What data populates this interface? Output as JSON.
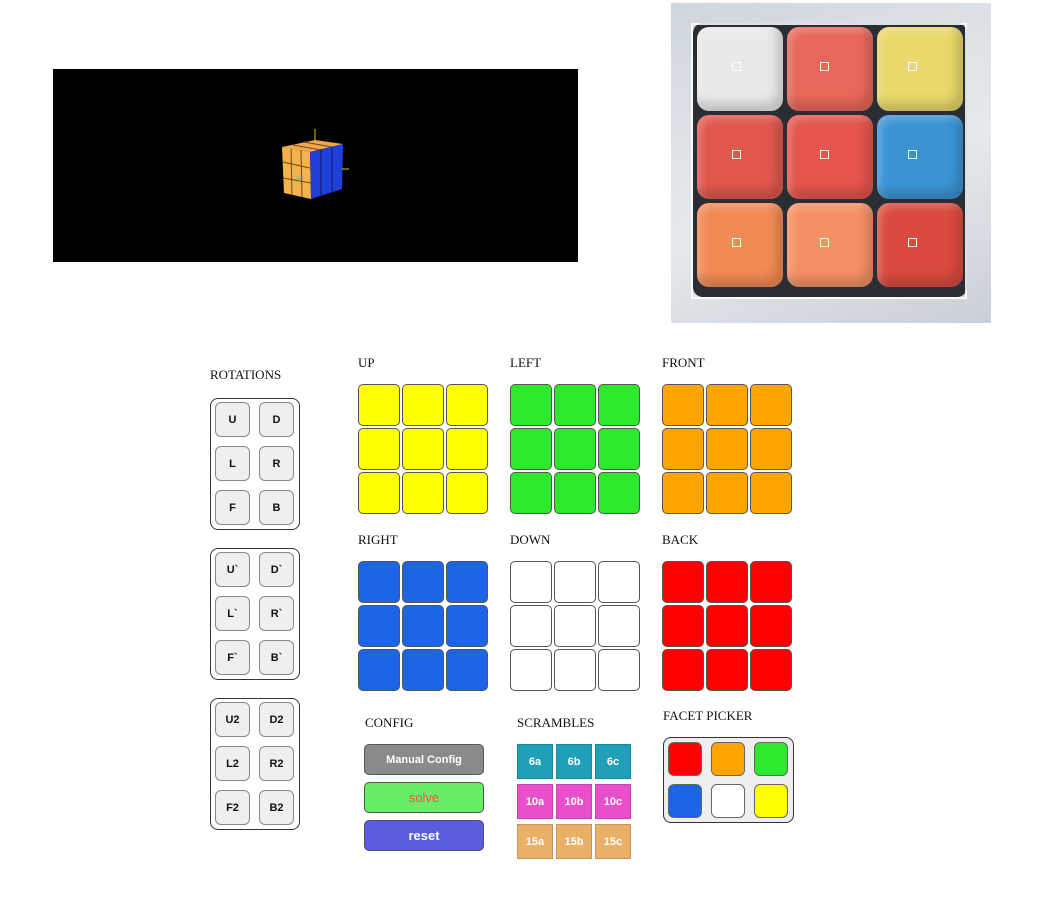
{
  "viewport": {
    "cube_colors": {
      "top": "#f2a74e",
      "front": "#f4b24d",
      "side": "#1f3fd6",
      "background": "#000000"
    }
  },
  "camera": {
    "stickers": [
      "#e9e9e9",
      "#e8675a",
      "#e9d86a",
      "#e0574c",
      "#e5554c",
      "#3a94d4",
      "#f28a55",
      "#f59065",
      "#da4a3e"
    ]
  },
  "rotations": {
    "title": "ROTATIONS",
    "groups": [
      [
        "U",
        "D",
        "L",
        "R",
        "F",
        "B"
      ],
      [
        "U`",
        "D`",
        "L`",
        "R`",
        "F`",
        "B`"
      ],
      [
        "U2",
        "D2",
        "L2",
        "R2",
        "F2",
        "B2"
      ]
    ]
  },
  "faces": [
    {
      "label": "UP",
      "color": "#ffff00",
      "facets": [
        "#ffff00",
        "#ffff00",
        "#ffff00",
        "#ffff00",
        "#ffff00",
        "#ffff00",
        "#ffff00",
        "#ffff00",
        "#ffff00"
      ]
    },
    {
      "label": "LEFT",
      "color": "#2ee82e",
      "facets": [
        "#2ee82e",
        "#2ee82e",
        "#2ee82e",
        "#2ee82e",
        "#2ee82e",
        "#2ee82e",
        "#2ee82e",
        "#2ee82e",
        "#2ee82e"
      ]
    },
    {
      "label": "FRONT",
      "color": "#ffa500",
      "facets": [
        "#ffa500",
        "#ffa500",
        "#ffa500",
        "#ffa500",
        "#ffa500",
        "#ffa500",
        "#ffa500",
        "#ffa500",
        "#ffa500"
      ]
    },
    {
      "label": "RIGHT",
      "color": "#1c66e6",
      "facets": [
        "#1c66e6",
        "#1c66e6",
        "#1c66e6",
        "#1c66e6",
        "#1c66e6",
        "#1c66e6",
        "#1c66e6",
        "#1c66e6",
        "#1c66e6"
      ]
    },
    {
      "label": "DOWN",
      "color": "#ffffff",
      "facets": [
        "#ffffff",
        "#ffffff",
        "#ffffff",
        "#ffffff",
        "#ffffff",
        "#ffffff",
        "#ffffff",
        "#ffffff",
        "#ffffff"
      ]
    },
    {
      "label": "BACK",
      "color": "#ff0000",
      "facets": [
        "#ff0000",
        "#ff0000",
        "#ff0000",
        "#ff0000",
        "#ff0000",
        "#ff0000",
        "#ff0000",
        "#ff0000",
        "#ff0000"
      ]
    }
  ],
  "config": {
    "title": "CONFIG",
    "manual_label": "Manual Config",
    "solve_label": "solve",
    "reset_label": "reset",
    "manual_color": "#8a8a8a",
    "solve_color": "#66ee66",
    "solve_text_color": "#ff4d4d",
    "reset_color": "#5b5bdf"
  },
  "scrambles": {
    "title": "SCRAMBLES",
    "rows": [
      {
        "color": "#1fa0b8",
        "items": [
          "6a",
          "6b",
          "6c"
        ]
      },
      {
        "color": "#ea4fcb",
        "items": [
          "10a",
          "10b",
          "10c"
        ]
      },
      {
        "color": "#e9b06a",
        "items": [
          "15a",
          "15b",
          "15c"
        ]
      }
    ]
  },
  "picker": {
    "title": "FACET PICKER",
    "colors": [
      "#ff0000",
      "#ffa500",
      "#2ee82e",
      "#1c66e6",
      "#ffffff",
      "#ffff00"
    ]
  }
}
